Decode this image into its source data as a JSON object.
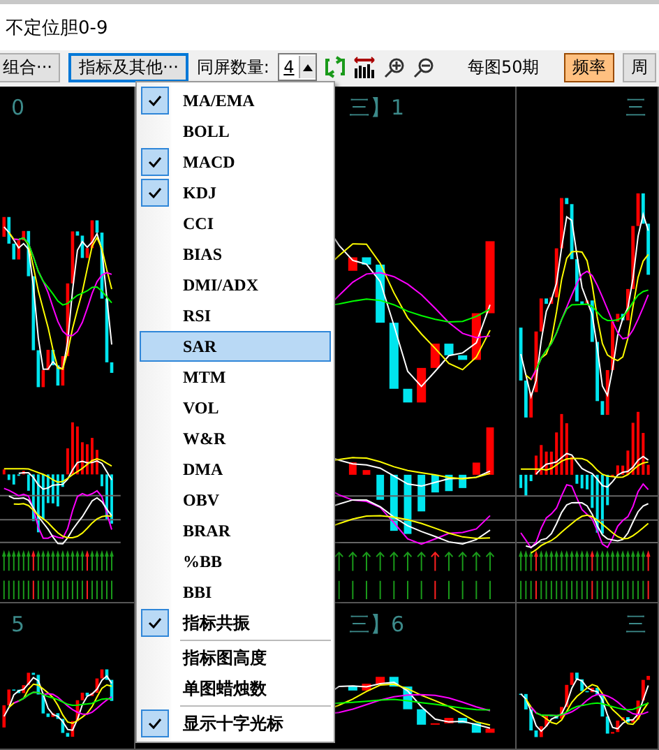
{
  "window": {
    "title": "不定位胆0-9"
  },
  "toolbar": {
    "combo_button": "组合···",
    "indicator_button": "指标及其他···",
    "count_label": "同屏数量:",
    "count_value": "4",
    "per_chart": "每图50期",
    "frequency_button": "频率",
    "period_button": "周"
  },
  "panels": [
    {
      "label": "0"
    },
    {
      "label": "三】1"
    },
    {
      "label": "三"
    },
    {
      "label": "5"
    },
    {
      "label": "三】6"
    },
    {
      "label": "三"
    }
  ],
  "menu": {
    "items": [
      {
        "kind": "item",
        "label": "MA/EMA",
        "checked": true,
        "selected": false
      },
      {
        "kind": "item",
        "label": "BOLL",
        "checked": false,
        "selected": false
      },
      {
        "kind": "item",
        "label": "MACD",
        "checked": true,
        "selected": false
      },
      {
        "kind": "item",
        "label": "KDJ",
        "checked": true,
        "selected": false
      },
      {
        "kind": "item",
        "label": "CCI",
        "checked": false,
        "selected": false
      },
      {
        "kind": "item",
        "label": "BIAS",
        "checked": false,
        "selected": false
      },
      {
        "kind": "item",
        "label": "DMI/ADX",
        "checked": false,
        "selected": false
      },
      {
        "kind": "item",
        "label": "RSI",
        "checked": false,
        "selected": false
      },
      {
        "kind": "item",
        "label": "SAR",
        "checked": false,
        "selected": true
      },
      {
        "kind": "item",
        "label": "MTM",
        "checked": false,
        "selected": false
      },
      {
        "kind": "item",
        "label": "VOL",
        "checked": false,
        "selected": false
      },
      {
        "kind": "item",
        "label": "W&R",
        "checked": false,
        "selected": false
      },
      {
        "kind": "item",
        "label": "DMA",
        "checked": false,
        "selected": false
      },
      {
        "kind": "item",
        "label": "OBV",
        "checked": false,
        "selected": false
      },
      {
        "kind": "item",
        "label": "BRAR",
        "checked": false,
        "selected": false
      },
      {
        "kind": "item",
        "label": "%BB",
        "checked": false,
        "selected": false
      },
      {
        "kind": "item",
        "label": "BBI",
        "checked": false,
        "selected": false
      },
      {
        "kind": "item",
        "label": "指标共振",
        "checked": true,
        "selected": false
      },
      {
        "kind": "separator"
      },
      {
        "kind": "item",
        "label": "指标图高度",
        "checked": false,
        "selected": false
      },
      {
        "kind": "item",
        "label": "单图蜡烛数",
        "checked": false,
        "selected": false
      },
      {
        "kind": "separator"
      },
      {
        "kind": "item",
        "label": "显示十字光标",
        "checked": true,
        "selected": false
      }
    ]
  }
}
